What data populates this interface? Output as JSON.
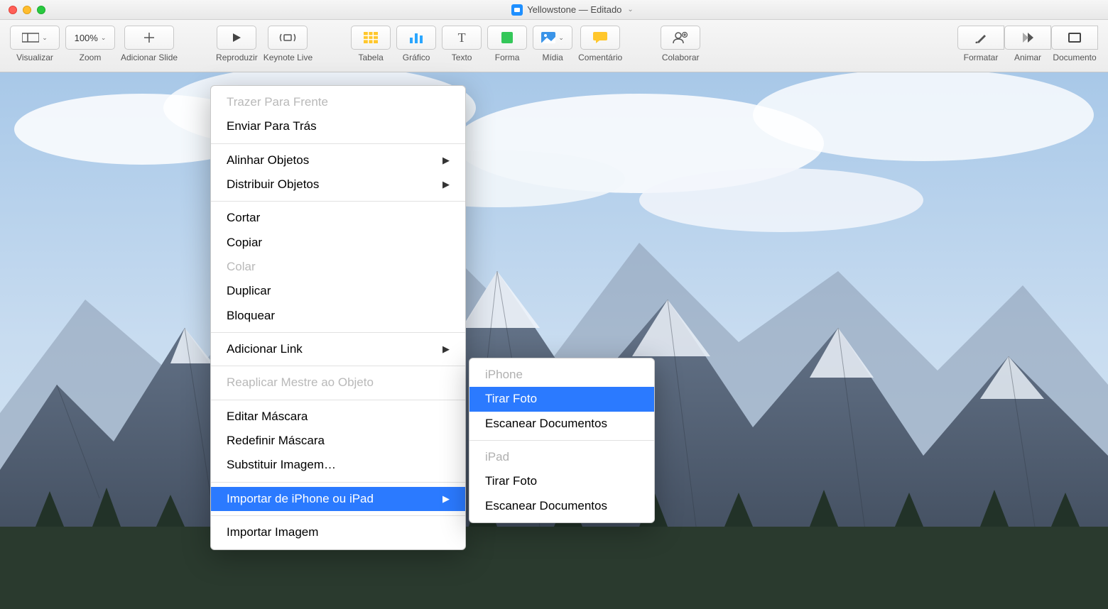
{
  "titlebar": {
    "title": "Yellowstone — Editado"
  },
  "toolbar": {
    "view": "Visualizar",
    "zoom": "Zoom",
    "zoom_value": "100%",
    "add_slide": "Adicionar Slide",
    "play": "Reproduzir",
    "keynote_live": "Keynote Live",
    "table": "Tabela",
    "chart": "Gráfico",
    "text": "Texto",
    "shape": "Forma",
    "media": "Mídia",
    "comment": "Comentário",
    "collaborate": "Colaborar",
    "format": "Formatar",
    "animate": "Animar",
    "document": "Documento"
  },
  "context_menu": {
    "bring_forward": "Trazer Para Frente",
    "send_backward": "Enviar Para Trás",
    "align_objects": "Alinhar Objetos",
    "distribute_objects": "Distribuir Objetos",
    "cut": "Cortar",
    "copy": "Copiar",
    "paste": "Colar",
    "duplicate": "Duplicar",
    "lock": "Bloquear",
    "add_link": "Adicionar Link",
    "reapply_master": "Reaplicar Mestre ao Objeto",
    "edit_mask": "Editar Máscara",
    "reset_mask": "Redefinir Máscara",
    "replace_image": "Substituir Imagem…",
    "import_iphone_ipad": "Importar de iPhone ou iPad",
    "import_image": "Importar Imagem"
  },
  "submenu": {
    "iphone_header": "iPhone",
    "take_photo_1": "Tirar Foto",
    "scan_docs_1": "Escanear Documentos",
    "ipad_header": "iPad",
    "take_photo_2": "Tirar Foto",
    "scan_docs_2": "Escanear Documentos"
  }
}
